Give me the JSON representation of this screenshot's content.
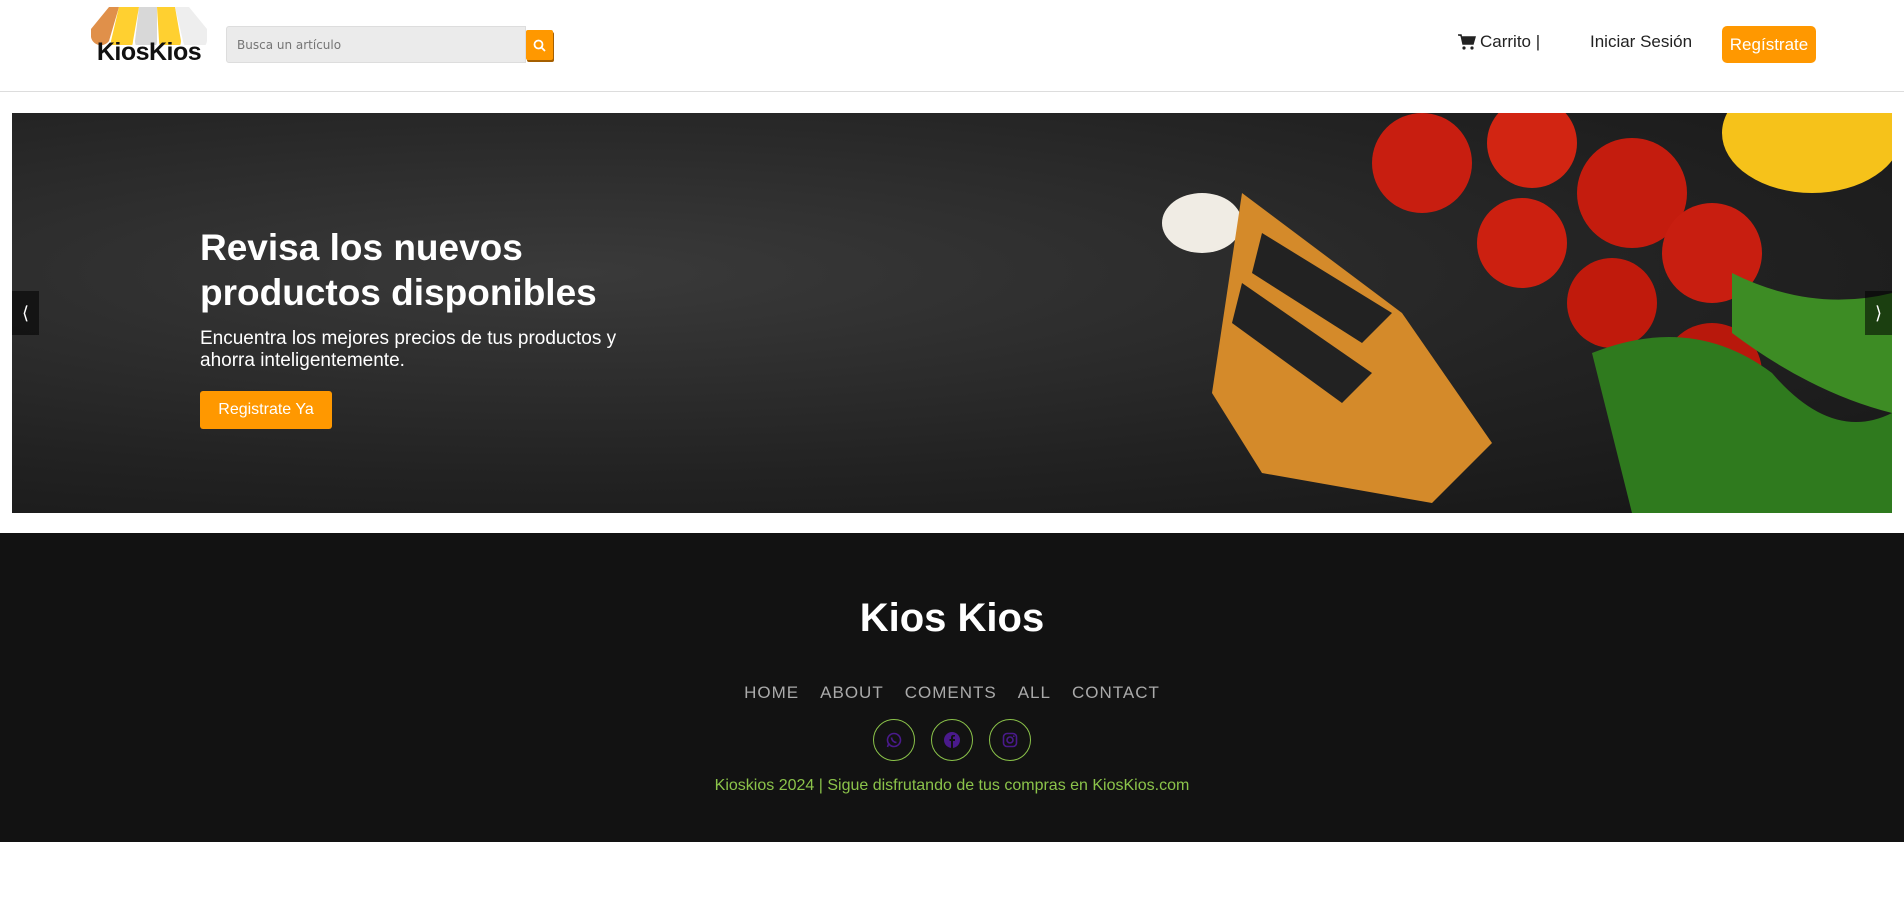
{
  "header": {
    "logo_text": "KiosKios",
    "search_placeholder": "Busca un artículo",
    "cart_label": "Carrito |",
    "login_label": "Iniciar Sesión",
    "register_label": "Regístrate"
  },
  "banner": {
    "title": "Revisa los nuevos productos disponibles",
    "subtitle": "Encuentra los mejores precios de tus productos y ahorra inteligentemente.",
    "cta_label": "Registrate Ya",
    "prev": "⟨",
    "next": "⟩"
  },
  "footer": {
    "title": "Kios Kios",
    "nav": [
      "HOME",
      "ABOUT",
      "COMENTS",
      "ALL",
      "CONTACT"
    ],
    "social": [
      "whatsapp-icon",
      "facebook-icon",
      "instagram-icon"
    ],
    "copyright": "Kioskios 2024 | Sigue disfrutando de tus compras en KiosKios.com"
  },
  "colors": {
    "accent": "#ff9800",
    "footer_bg": "#121212",
    "footer_green": "#8bc34a",
    "icon_purple": "#4a1a8c"
  }
}
